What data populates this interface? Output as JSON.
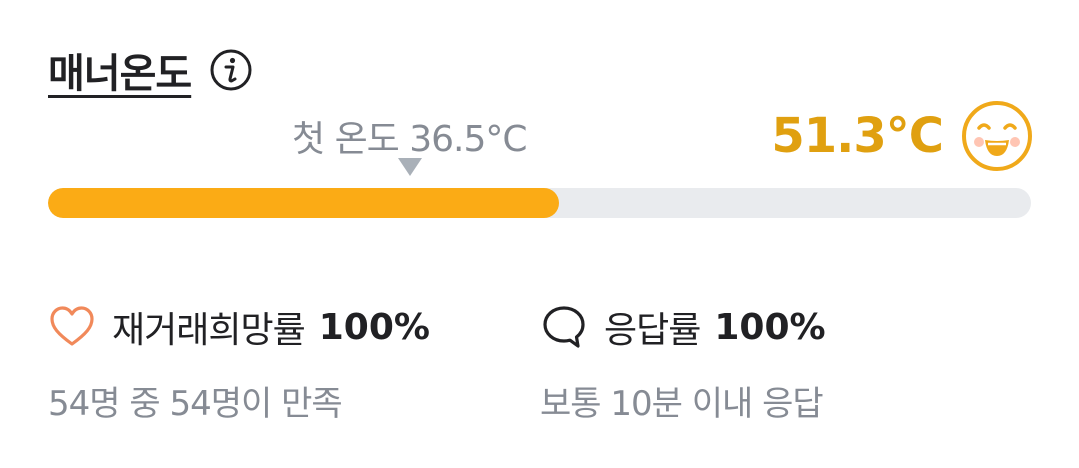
{
  "manner_temp": {
    "title": "매너온도",
    "info_icon": "info-icon",
    "first_temp_label": "첫 온도 36.5°C",
    "current_temp": "51.3°C",
    "current_temp_color": "#e0a010",
    "face_icon": "smiling-face-icon",
    "bar_fill_color": "#fbab15",
    "bar_track_color": "#e9ebee",
    "bar_fill_fraction": 0.52
  },
  "stats": {
    "rebuy": {
      "icon": "heart-outline-icon",
      "icon_color": "#f1895a",
      "label": "재거래희망률",
      "value": "100%",
      "sub": "54명 중 54명이 만족"
    },
    "response": {
      "icon": "speech-bubble-icon",
      "label": "응답률",
      "value": "100%",
      "sub": "보통 10분 이내 응답"
    }
  }
}
